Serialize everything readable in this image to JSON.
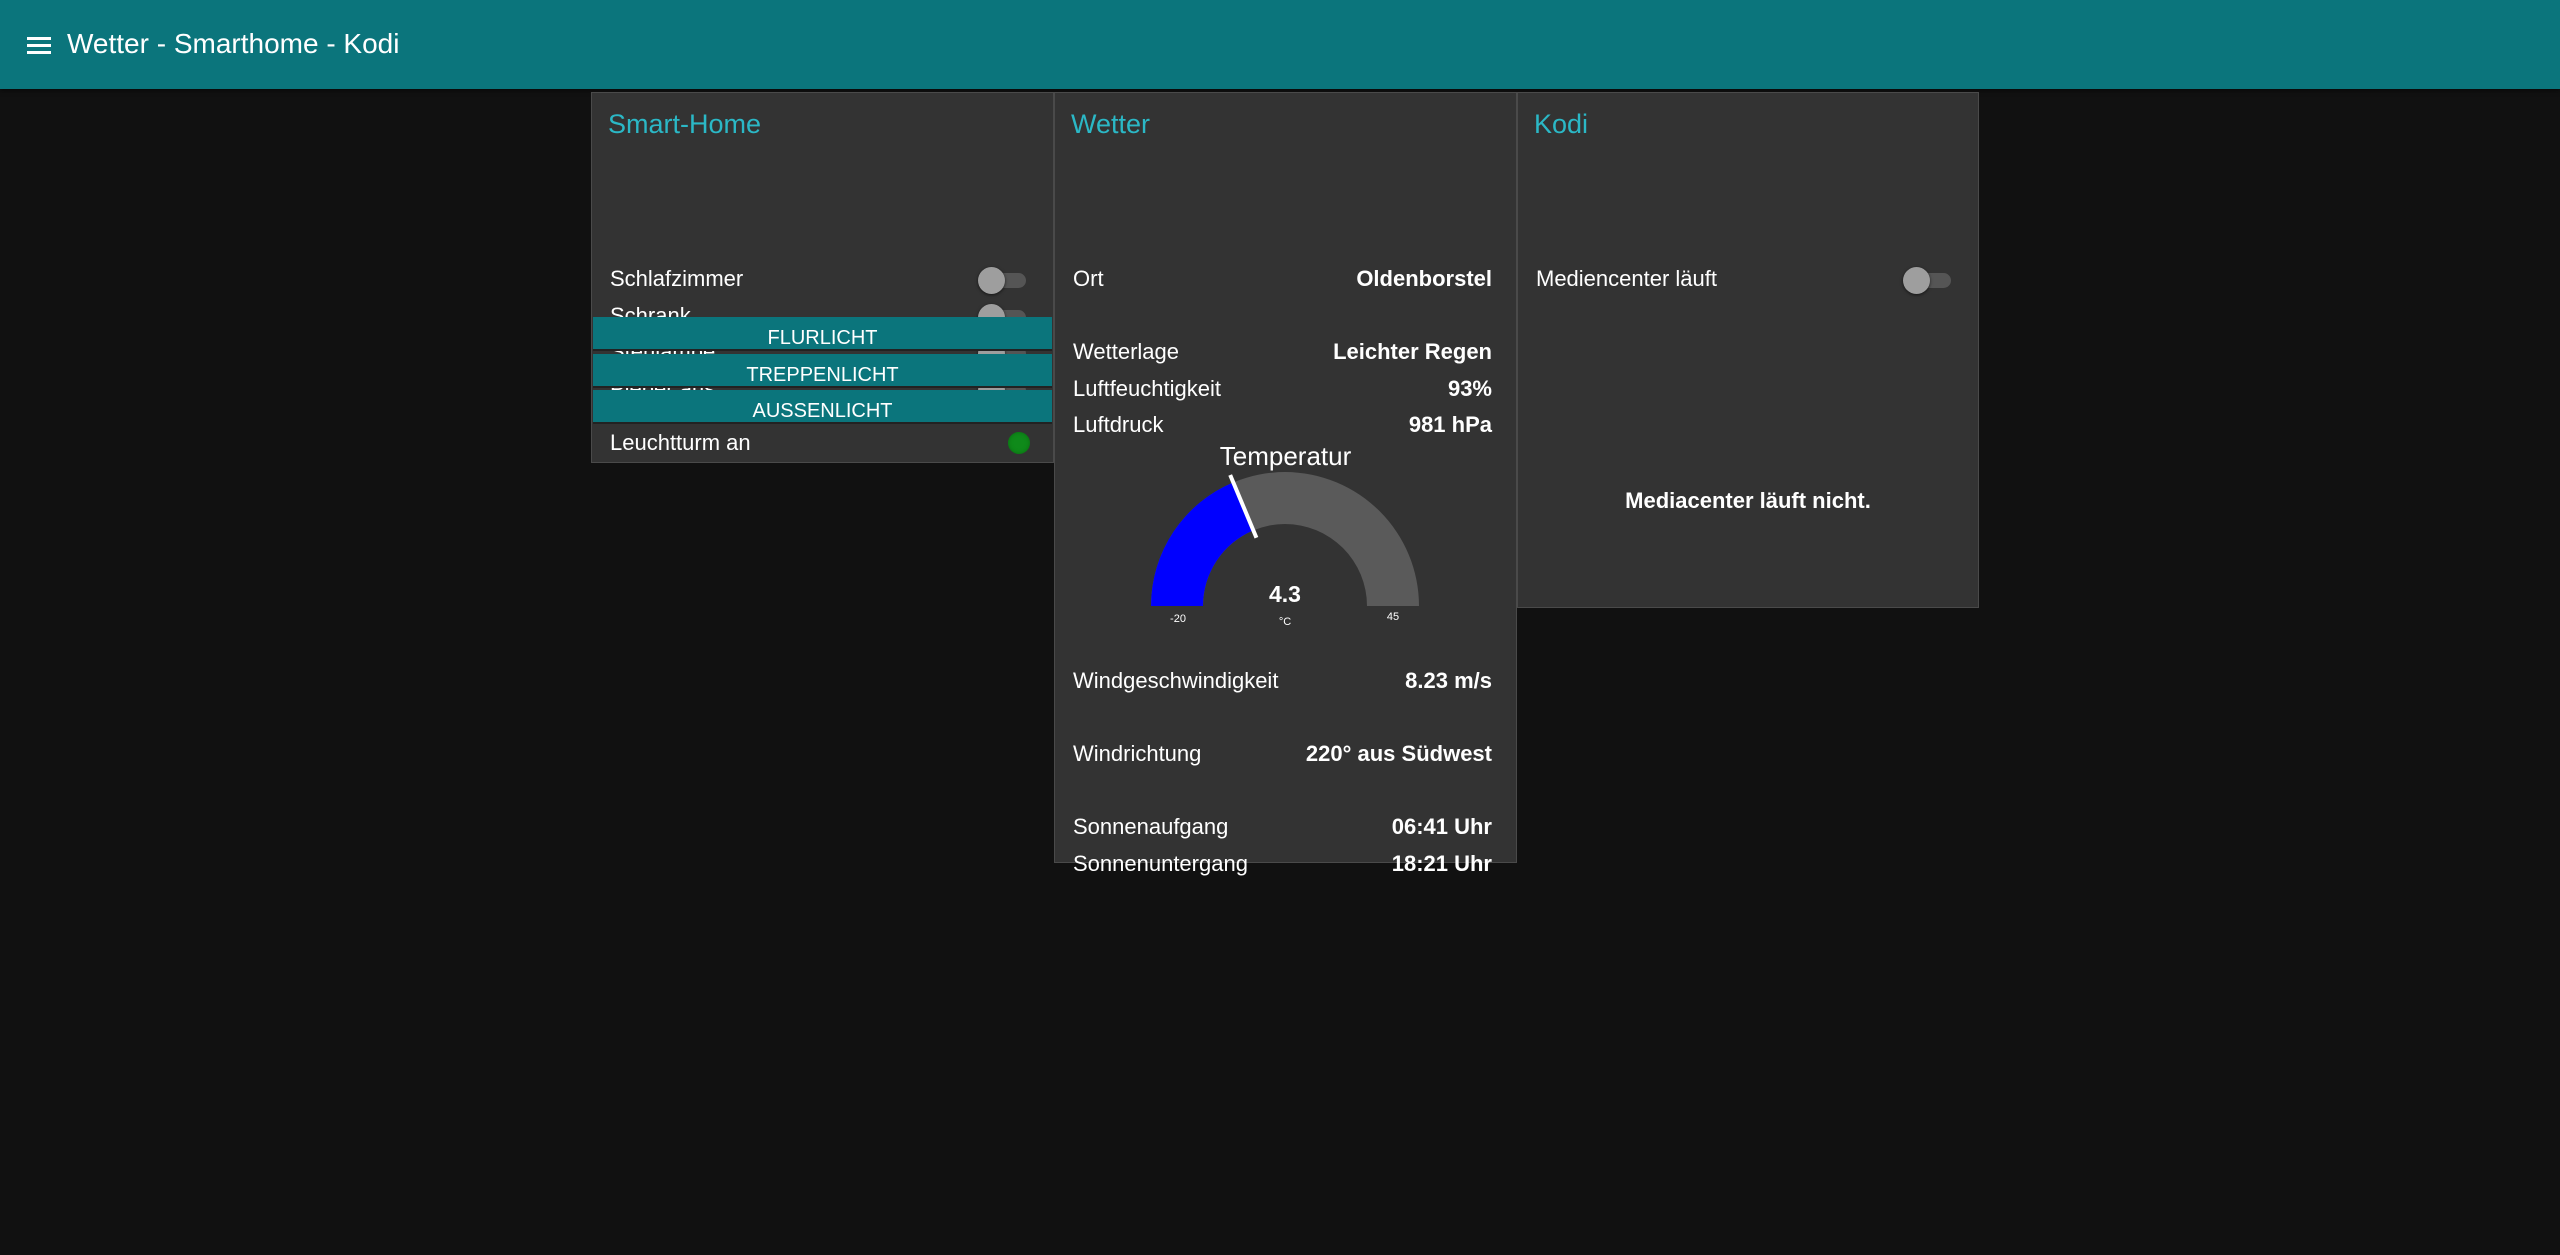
{
  "header": {
    "title": "Wetter - Smarthome - Kodi"
  },
  "smarthome": {
    "title": "Smart-Home",
    "switches": [
      {
        "label": "Schlafzimmer",
        "on": false
      },
      {
        "label": "Schrank",
        "on": false
      },
      {
        "label": "Stehlampe",
        "on": false
      },
      {
        "label": "Pieper aus",
        "on": false
      }
    ],
    "buttons": [
      "FLURLICHT",
      "TREPPENLICHT",
      "AUSSENLICHT"
    ],
    "indicator": {
      "label": "Leuchtturm an",
      "color": "#0f8a1a"
    }
  },
  "weather": {
    "title": "Wetter",
    "ort_label": "Ort",
    "ort_value": "Oldenborstel",
    "wetterlage_label": "Wetterlage",
    "wetterlage_value": "Leichter Regen",
    "humidity_label": "Luftfeuchtigkeit",
    "humidity_value": "93%",
    "pressure_label": "Luftdruck",
    "pressure_value": "981 hPa",
    "gauge": {
      "title": "Temperatur",
      "value": 4.3,
      "value_text": "4.3",
      "unit": "°C",
      "min": -20,
      "max": 45,
      "min_text": "-20",
      "max_text": "45",
      "fill_color": "#0000ff",
      "track_color": "#5a5a5a"
    },
    "wind_speed_label": "Windgeschwindigkeit",
    "wind_speed_value": "8.23 m/s",
    "wind_dir_label": "Windrichtung",
    "wind_dir_value": "220° aus Südwest",
    "sunrise_label": "Sonnenaufgang",
    "sunrise_value": "06:41 Uhr",
    "sunset_label": "Sonnenuntergang",
    "sunset_value": "18:21 Uhr"
  },
  "kodi": {
    "title": "Kodi",
    "switch_label": "Mediencenter läuft",
    "switch_on": false,
    "message": "Mediacenter läuft nicht."
  },
  "colors": {
    "accent": "#0b757c",
    "title": "#2bb8c6",
    "card": "#333333",
    "background": "#111111"
  }
}
